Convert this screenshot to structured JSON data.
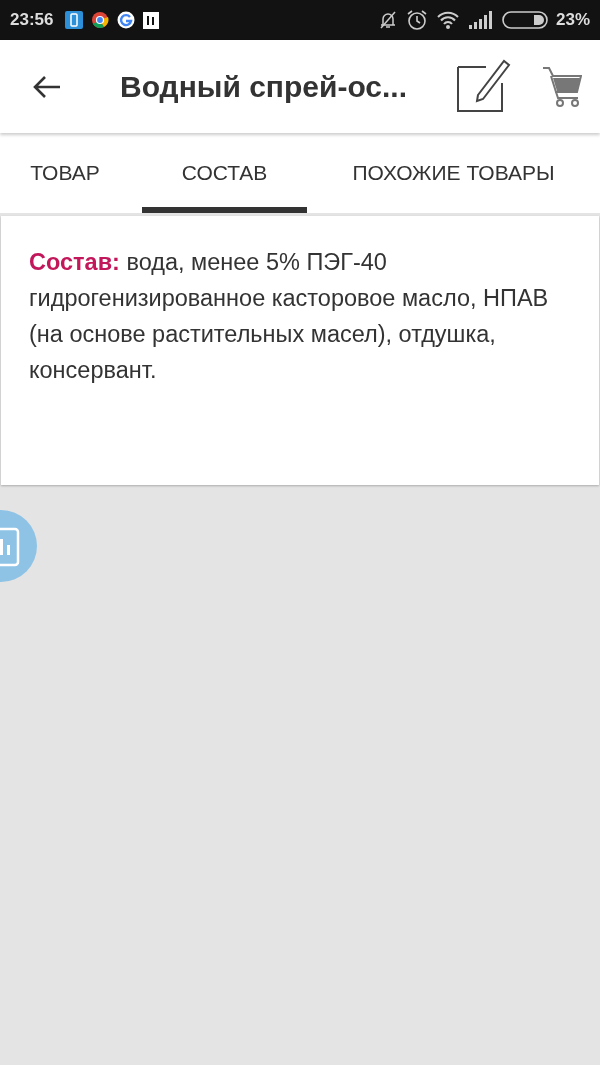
{
  "status_bar": {
    "time": "23:56",
    "battery": "23%"
  },
  "app_bar": {
    "title": "Водный спрей-ос..."
  },
  "tabs": [
    {
      "label": "ТОВАР",
      "selected": false
    },
    {
      "label": "СОСТАВ",
      "selected": true
    },
    {
      "label": "ПОХОЖИЕ ТОВАРЫ",
      "selected": false
    }
  ],
  "composition": {
    "text": "**Состав:** вода, менее 5% ПЭГ-40 гидрогенизированное касторовое масло, НПАВ (на основе растительных масел), отдушка, консервант."
  }
}
